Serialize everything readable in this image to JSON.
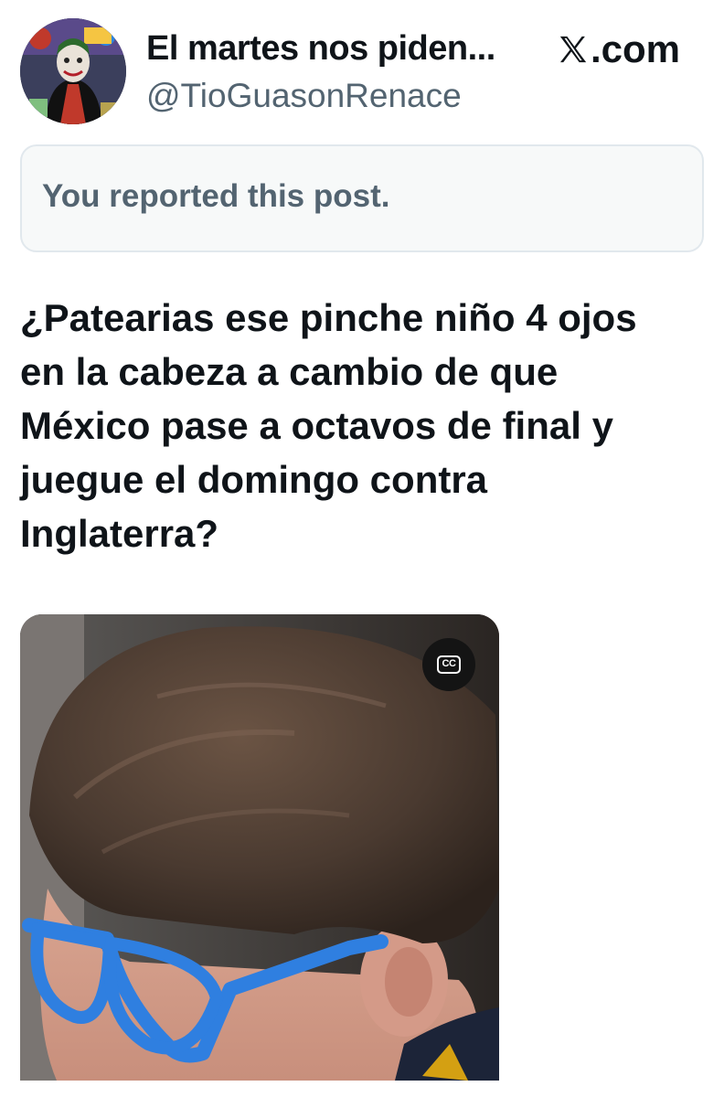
{
  "header": {
    "display_name": "El martes nos piden...",
    "handle": "@TioGuasonRenace",
    "brand": ".com",
    "brand_icon": "x-logo-icon"
  },
  "notice": {
    "text": "You reported this post."
  },
  "tweet": {
    "lines": [
      "¿Patearias ese pinche niño 4 ojos",
      "en la cabeza a cambio de que",
      "México pase a octavos de final y",
      "juegue el domingo contra",
      "Inglaterra?"
    ]
  },
  "media": {
    "cc_label": "CC",
    "cc_icon": "closed-captions-icon"
  },
  "colors": {
    "text_primary": "#0f1419",
    "text_secondary": "#536471",
    "notice_bg": "#f7f9f9",
    "notice_border": "#e1e8ed",
    "glasses_blue": "#2f7fe0"
  }
}
